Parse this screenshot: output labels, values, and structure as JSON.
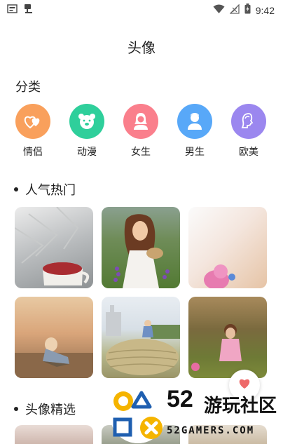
{
  "status_bar": {
    "time": "9:42",
    "icons": [
      "notification-icon",
      "app-icon",
      "wifi-icon",
      "no-signal-icon",
      "battery-charging-icon"
    ]
  },
  "header": {
    "title": "头像"
  },
  "categories": {
    "title": "分类",
    "items": [
      {
        "label": "情侣",
        "icon": "hearts-icon",
        "color": "#f9a05c"
      },
      {
        "label": "动漫",
        "icon": "bear-icon",
        "color": "#2fcf9b"
      },
      {
        "label": "女生",
        "icon": "girl-icon",
        "color": "#fa7f8c"
      },
      {
        "label": "男生",
        "icon": "boy-icon",
        "color": "#58a8f8"
      },
      {
        "label": "欧美",
        "icon": "face-profile-icon",
        "color": "#9b87ef"
      }
    ]
  },
  "popular": {
    "title": "人气热门",
    "photos": [
      {
        "icon": "photo-knit-sweater-mug"
      },
      {
        "icon": "photo-girl-in-field"
      },
      {
        "icon": "photo-soft-pink-toy"
      },
      {
        "icon": "photo-child-sitting-sunset"
      },
      {
        "icon": "photo-child-on-hay-bale"
      },
      {
        "icon": "photo-toddler-in-grass"
      }
    ]
  },
  "featured": {
    "title": "头像精选"
  },
  "fab": {
    "icon": "heart-icon",
    "color": "#ee6a6a"
  },
  "watermark": {
    "number": "52",
    "chinese": "游玩社区",
    "english": "52GAMERS.COM"
  }
}
